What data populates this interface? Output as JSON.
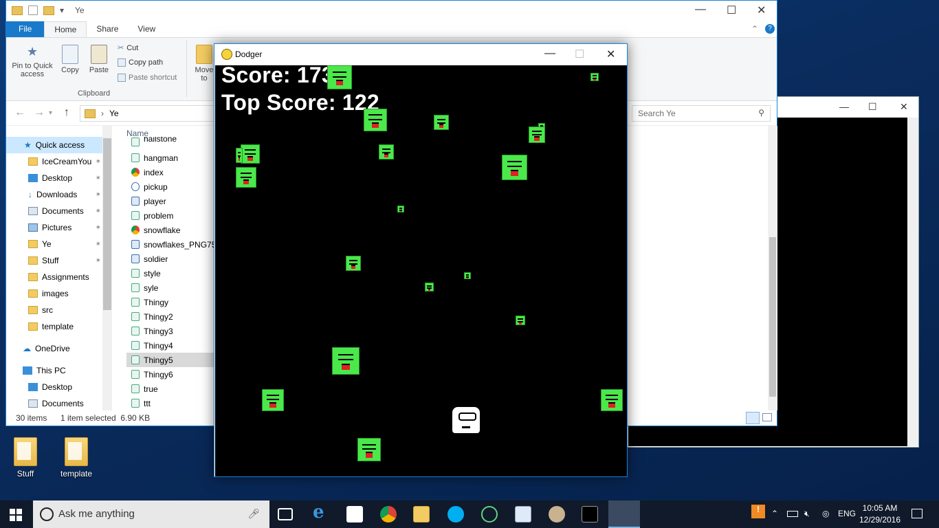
{
  "desktop": {
    "icons": [
      {
        "label": "Stuff"
      },
      {
        "label": "template"
      }
    ]
  },
  "explorer": {
    "title": "Ye",
    "tabs": [
      "File",
      "Home",
      "Share",
      "View"
    ],
    "ribbon": {
      "pin_label": "Pin to Quick access",
      "copy_label": "Copy",
      "paste_label": "Paste",
      "cut_label": "Cut",
      "copy_path_label": "Copy path",
      "paste_shortcut_label": "Paste shortcut",
      "move_to_label": "Move to",
      "group_clipboard": "Clipboard"
    },
    "address": {
      "folder": "Ye",
      "search_placeholder": "Search Ye"
    },
    "nav_items": [
      {
        "label": "Quick access"
      },
      {
        "label": "IceCreamYou"
      },
      {
        "label": "Desktop"
      },
      {
        "label": "Downloads"
      },
      {
        "label": "Documents"
      },
      {
        "label": "Pictures"
      },
      {
        "label": "Ye"
      },
      {
        "label": "Stuff"
      },
      {
        "label": "Assignments"
      },
      {
        "label": "images"
      },
      {
        "label": "src"
      },
      {
        "label": "template"
      },
      {
        "label": "OneDrive"
      },
      {
        "label": "This PC"
      },
      {
        "label": "Desktop"
      },
      {
        "label": "Documents"
      }
    ],
    "column_name": "Name",
    "files": [
      {
        "name": "hailstone"
      },
      {
        "name": "hangman"
      },
      {
        "name": "index"
      },
      {
        "name": "pickup"
      },
      {
        "name": "player"
      },
      {
        "name": "problem"
      },
      {
        "name": "snowflake"
      },
      {
        "name": "snowflakes_PNG758"
      },
      {
        "name": "soldier"
      },
      {
        "name": "style"
      },
      {
        "name": "syle"
      },
      {
        "name": "Thingy"
      },
      {
        "name": "Thingy2"
      },
      {
        "name": "Thingy3"
      },
      {
        "name": "Thingy4"
      },
      {
        "name": "Thingy5"
      },
      {
        "name": "Thingy6"
      },
      {
        "name": "true"
      },
      {
        "name": "ttt"
      }
    ],
    "status": {
      "items": "30 items",
      "selected": "1 item selected  6.90 KB"
    }
  },
  "dodger": {
    "title": "Dodger",
    "score_text": "Score: 173",
    "top_score_text": "Top Score: 122"
  },
  "taskbar": {
    "search_placeholder": "Ask me anything",
    "lang": "ENG",
    "time": "10:05 AM",
    "date": "12/29/2016"
  },
  "colors": {
    "accent": "#1979ca",
    "baddie": "#4ae84a",
    "taskbar": "#101a2a"
  }
}
